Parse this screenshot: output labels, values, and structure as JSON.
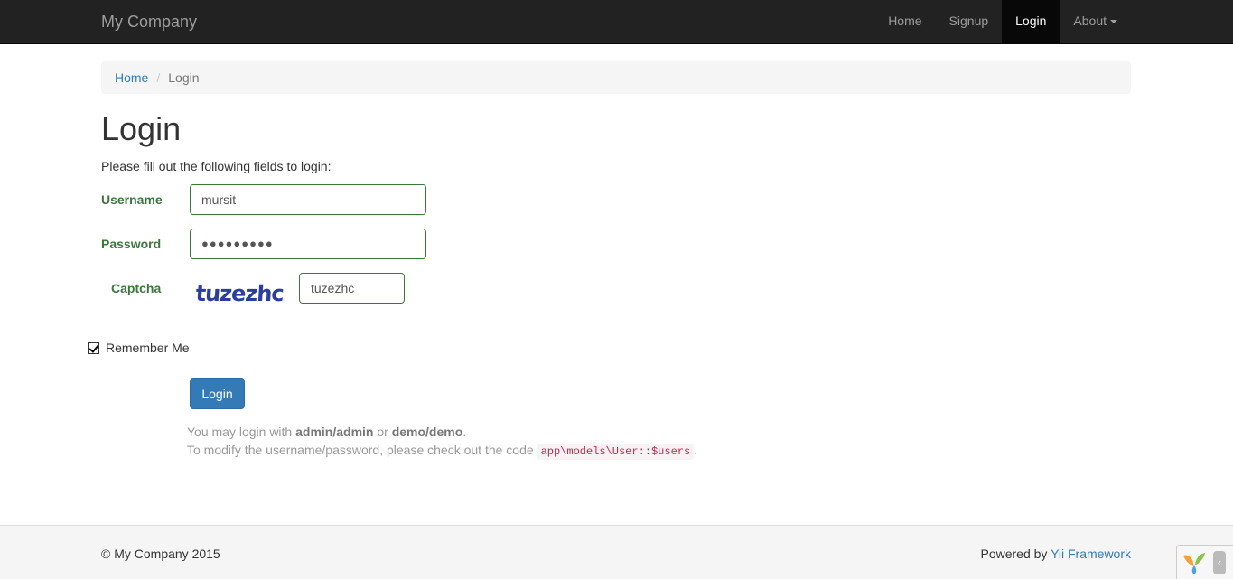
{
  "navbar": {
    "brand": "My Company",
    "items": [
      {
        "label": "Home",
        "active": false
      },
      {
        "label": "Signup",
        "active": false
      },
      {
        "label": "Login",
        "active": true
      },
      {
        "label": "About",
        "active": false,
        "dropdown": true
      }
    ]
  },
  "breadcrumb": {
    "home": "Home",
    "separator": "/",
    "current": "Login"
  },
  "page": {
    "title": "Login",
    "intro": "Please fill out the following fields to login:"
  },
  "form": {
    "username_label": "Username",
    "username_value": "mursit",
    "password_label": "Password",
    "password_value": "●●●●●●●●●",
    "captcha_label": "Captcha",
    "captcha_image_text": "tuzezhc",
    "captcha_value": "tuzezhc",
    "remember_label": "Remember Me",
    "remember_checked": true,
    "submit_label": "Login"
  },
  "hint": {
    "line1_prefix": "You may login with ",
    "line1_cred1": "admin/admin",
    "line1_or": " or ",
    "line1_cred2": "demo/demo",
    "line1_suffix": ".",
    "line2_prefix": "To modify the username/password, please check out the code ",
    "line2_code": "app\\models\\User::$users",
    "line2_suffix": "."
  },
  "footer": {
    "copyright": "© My Company 2015",
    "powered_prefix": "Powered by ",
    "powered_link": "Yii Framework"
  },
  "colors": {
    "navbar_bg": "#222222",
    "link": "#337ab7",
    "success_green": "#3c763d",
    "primary_button": "#337ab7"
  }
}
